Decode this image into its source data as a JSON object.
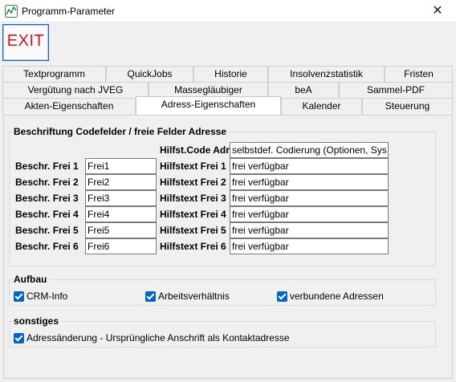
{
  "window": {
    "title": "Programm-Parameter"
  },
  "toolbar": {
    "exit_label": "EXIT"
  },
  "tabs": {
    "row1": [
      "Textprogramm",
      "QuickJobs",
      "Historie",
      "Insolvenzstatistik",
      "Fristen"
    ],
    "row2": [
      "Vergütung nach JVEG",
      "Massegläubiger",
      "beA",
      "Sammel-PDF"
    ],
    "row3": [
      "Akten-Eigenschaften",
      "Adress-Eigenschaften",
      "Kalender",
      "Steuerung"
    ],
    "active": "Adress-Eigenschaften"
  },
  "codefelder": {
    "title": "Beschriftung Codefelder / freie Felder Adresse",
    "hilfst_code_label": "Hilfst.Code Adr.",
    "hilfst_code_value": "selbstdef. Codierung (Optionen, Sys",
    "rows": [
      {
        "beschr_label": "Beschr. Frei 1",
        "beschr_value": "Frei1",
        "hilfstext_label": "Hilfstext Frei 1",
        "hilfstext_value": "frei verfügbar"
      },
      {
        "beschr_label": "Beschr. Frei 2",
        "beschr_value": "Frei2",
        "hilfstext_label": "Hilfstext Frei 2",
        "hilfstext_value": "frei verfügbar"
      },
      {
        "beschr_label": "Beschr. Frei 3",
        "beschr_value": "Frei3",
        "hilfstext_label": "Hilfstext Frei 3",
        "hilfstext_value": "frei verfügbar"
      },
      {
        "beschr_label": "Beschr. Frei 4",
        "beschr_value": "Frei4",
        "hilfstext_label": "Hilfstext Frei 4",
        "hilfstext_value": "frei verfügbar"
      },
      {
        "beschr_label": "Beschr. Frei 5",
        "beschr_value": "Frei5",
        "hilfstext_label": "Hilfstext Frei 5",
        "hilfstext_value": "frei verfügbar"
      },
      {
        "beschr_label": "Beschr. Frei 6",
        "beschr_value": "Frei6",
        "hilfstext_label": "Hilfstext Frei 6",
        "hilfstext_value": "frei verfügbar"
      }
    ]
  },
  "aufbau": {
    "title": "Aufbau",
    "options": [
      {
        "label": "CRM-Info",
        "checked": true
      },
      {
        "label": "Arbeitsverhältnis",
        "checked": true
      },
      {
        "label": "verbundene Adressen",
        "checked": true
      }
    ]
  },
  "sonstiges": {
    "title": "sonstiges",
    "options": [
      {
        "label": "Adressänderung - Ursprüngliche Anschrift als Kontaktadresse",
        "checked": true
      }
    ]
  },
  "colors": {
    "exit_red": "#d0121b",
    "checkbox_blue": "#0066cc",
    "focus_blue": "#1e5fb4"
  }
}
